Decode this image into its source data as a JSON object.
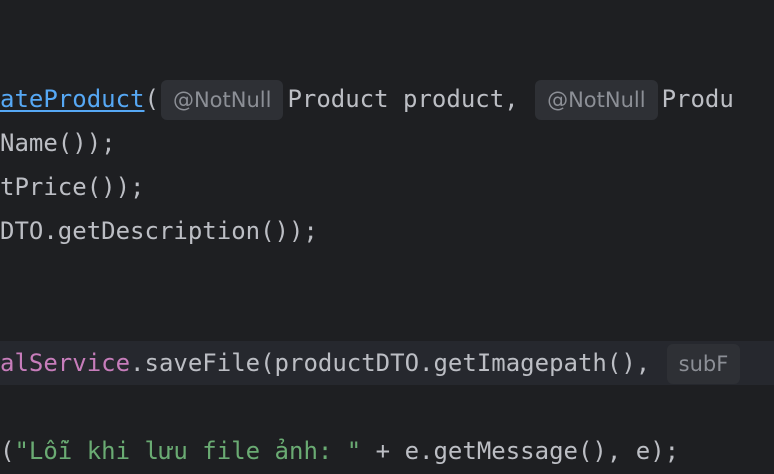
{
  "code": {
    "line1": {
      "fn_name": "ateProduct",
      "open_paren": "(",
      "hint1": "@NotNull",
      "param1": "Product product, ",
      "hint2": "@NotNull",
      "param2": "Produ"
    },
    "line2": "Name());",
    "line3": "tPrice());",
    "line4": "DTO.getDescription());",
    "line5": {
      "field": "alService",
      "call": ".saveFile(productDTO.getImagepath(), ",
      "hint": "subF"
    },
    "line6": {
      "prefix": "(",
      "string": "\"Lỗi khi lưu file ảnh: \"",
      "suffix": " + e.getMessage(), e);"
    }
  },
  "colors": {
    "background": "#1e1f22",
    "default_text": "#bcbec4",
    "method_link": "#56a8f5",
    "field": "#c77dbb",
    "string": "#6aab73",
    "inlay_hint_bg": "#2e3035",
    "inlay_hint_text": "#8c8f96"
  }
}
